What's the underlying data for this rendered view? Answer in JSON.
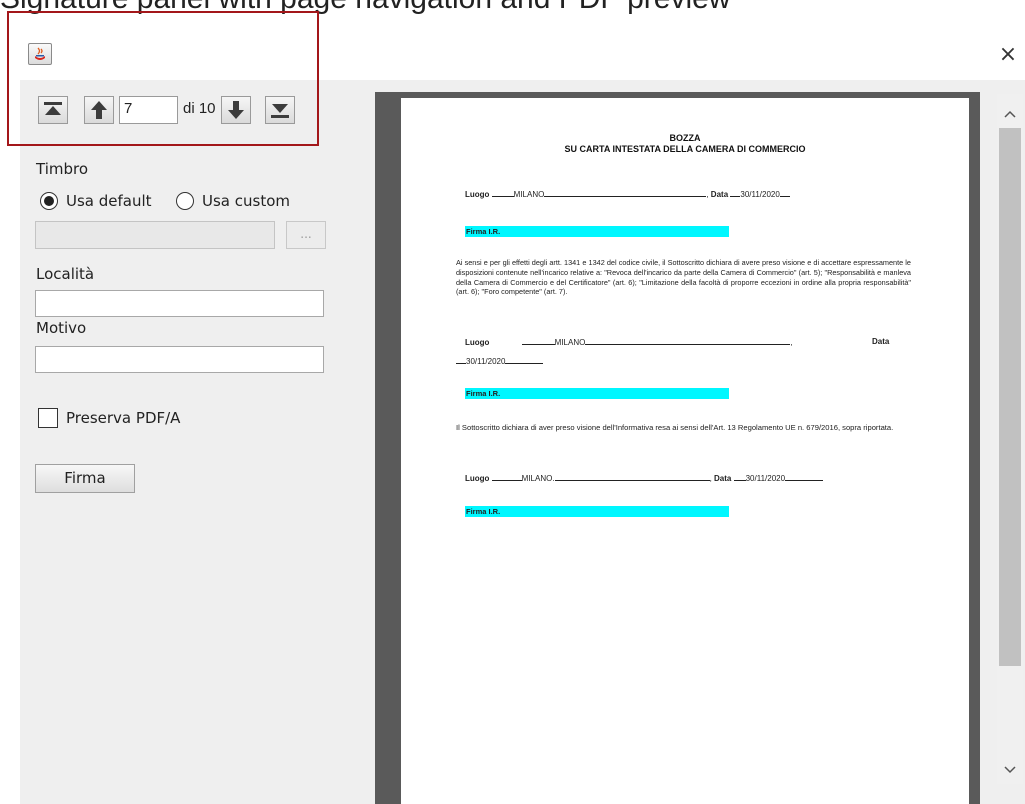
{
  "caption": {
    "text": "Signature panel with page navigation and PDF preview"
  },
  "window": {
    "close_glyph": "×"
  },
  "nav": {
    "page_value": "7",
    "of_label": "di 10"
  },
  "form": {
    "timbro_label": "Timbro",
    "radio_default": "Usa default",
    "radio_custom": "Usa custom",
    "browse_label": "...",
    "localita_label": "Località",
    "localita_value": "",
    "motivo_label": "Motivo",
    "motivo_value": "",
    "pdfa_label": "Preserva PDF/A",
    "sign_button": "Firma"
  },
  "document": {
    "title_line1": "BOZZA",
    "title_line2": "SU CARTA INTESTATA DELLA CAMERA DI COMMERCIO",
    "luogo_label": "Luogo",
    "data_label": "Data",
    "luogo_value": "MILANO",
    "date_value": "30/11/2020",
    "firma_label": "Firma I.R.",
    "para1": "Ai sensi e per gli effetti degli artt. 1341 e 1342 del codice civile, il Sottoscritto dichiara di avere preso visione e di accettare espressamente le disposizioni contenute nell'incarico relative a: \"Revoca dell'incarico da parte della Camera di Commercio\" (art. 5); \"Responsabilità e manleva della Camera di Commercio e del Certificatore\" (art. 6); \"Limitazione della facoltà di proporre eccezioni in ordine alla propria responsabilità\" (art. 6); \"Foro competente\" (art. 7).",
    "para2": "Il Sottoscritto dichiara di aver preso visione dell'Informativa resa ai sensi dell'Art. 13 Regolamento UE n. 679/2016, sopra riportata."
  },
  "colors": {
    "highlight_box": "#a3171a",
    "signature_field": "#00f7ff"
  },
  "icons": [
    "java-app-icon",
    "first-page-icon",
    "previous-page-icon",
    "next-page-icon",
    "last-page-icon",
    "close-icon",
    "scroll-up-icon",
    "scroll-down-icon"
  ]
}
